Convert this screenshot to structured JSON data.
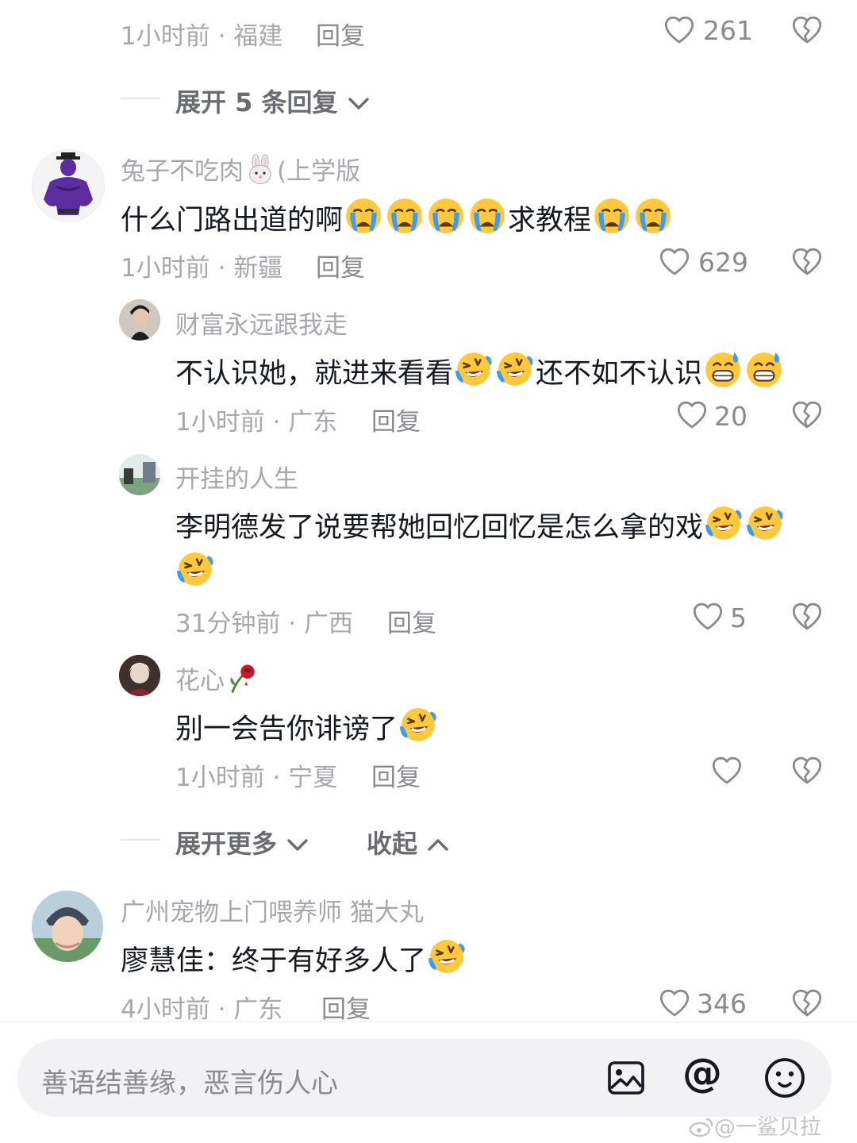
{
  "top": {
    "meta": "1小时前 · 福建",
    "reply_label": "回复",
    "likes": "261",
    "expand_label": "展开 5 条回复"
  },
  "comment1": {
    "username": "兔子不吃肉",
    "username_suffix": "(上学版",
    "text_a": "什么门路出道的啊",
    "text_b": "求教程",
    "meta": "1小时前 · 新疆",
    "reply_label": "回复",
    "likes": "629"
  },
  "reply1": {
    "username": "财富永远跟我走",
    "text_a": "不认识她，就进来看看",
    "text_b": "还不如不认识",
    "meta": "1小时前 · 广东",
    "reply_label": "回复",
    "likes": "20"
  },
  "reply2": {
    "username": "开挂的人生",
    "text_a": "李明德发了说要帮她回忆回忆是怎么拿的戏",
    "meta": "31分钟前 · 广西",
    "reply_label": "回复",
    "likes": "5"
  },
  "reply3": {
    "username": "花心",
    "text_a": "别一会告你诽谤了",
    "meta": "1小时前 · 宁夏",
    "reply_label": "回复",
    "likes": ""
  },
  "expand_more": {
    "more_label": "展开更多",
    "collapse_label": "收起"
  },
  "comment2": {
    "username": "广州宠物上门喂养师 猫大丸",
    "text_a": "廖慧佳：终于有好多人了",
    "meta": "4小时前 · 广东",
    "reply_label": "回复",
    "likes": "346"
  },
  "input": {
    "placeholder": "善语结善缘，恶言伤人心"
  },
  "watermark": "@一鲨贝拉",
  "colors": {
    "text": "#161823",
    "meta": "#a7a8ad",
    "input_bg": "#f2f2f4",
    "emoji_yellow": "#ffc83d",
    "tear_blue": "#3d9bf0"
  }
}
